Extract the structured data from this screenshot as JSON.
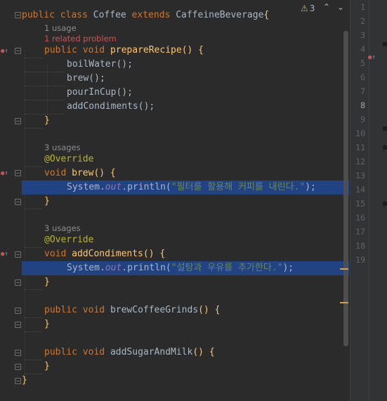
{
  "inspection": {
    "count": "3",
    "warning_icon": "warning-icon",
    "up_icon": "arrow-up-icon",
    "down_icon": "arrow-down-icon"
  },
  "code": {
    "class_decl": {
      "kw_public": "public",
      "kw_class": "class",
      "name": "Coffee",
      "kw_extends": "extends",
      "parent": "CaffeineBeverage",
      "brace": "{"
    },
    "prepare": {
      "usage_hint": "1 usage",
      "problem_hint": "1 related problem",
      "kw_public": "public",
      "kw_void": "void",
      "name": "prepareRecipe",
      "sig_rest": "() {",
      "calls": [
        "boilWater();",
        "brew();",
        "pourInCup();",
        "addCondiments();"
      ],
      "close": "}"
    },
    "brew": {
      "usage_hint": "3 usages",
      "annotation": "@Override",
      "kw_void": "void",
      "name": "brew",
      "sig_rest": "() {",
      "stmt_obj": "System.",
      "stmt_field": "out",
      "stmt_call": ".println(",
      "stmt_str": "\"필터를 활용해 커피를 내린다.\"",
      "stmt_end": ");",
      "close": "}"
    },
    "condiments": {
      "usage_hint": "3 usages",
      "annotation": "@Override",
      "kw_void": "void",
      "name": "addCondiments",
      "sig_rest": "() {",
      "stmt_obj": "System.",
      "stmt_field": "out",
      "stmt_call": ".println(",
      "stmt_str": "\"설탕과 우유를 추가한다.\"",
      "stmt_end": ");",
      "close": "}"
    },
    "grinds": {
      "kw_public": "public",
      "kw_void": "void",
      "name": "brewCoffeeGrinds",
      "sig_rest": "() {",
      "close": "}"
    },
    "sugar": {
      "kw_public": "public",
      "kw_void": "void",
      "name": "addSugarAndMilk",
      "sig_rest": "() {",
      "close": "}"
    },
    "class_close": "}"
  },
  "right_line_numbers": [
    "1",
    "2",
    "3",
    "4",
    "5",
    "6",
    "7",
    "8",
    "9",
    "10",
    "11",
    "12",
    "13",
    "14",
    "15",
    "16",
    "17",
    "18",
    "19"
  ],
  "right_current_line": "8",
  "colors": {
    "background": "#2b2b2b",
    "keyword": "#cc7832",
    "method": "#ffc66d",
    "annotation": "#bbb529",
    "string": "#6a8759",
    "static_field": "#9876aa",
    "selection": "#214283",
    "warning": "#e0b24e",
    "problem": "#d25252"
  }
}
